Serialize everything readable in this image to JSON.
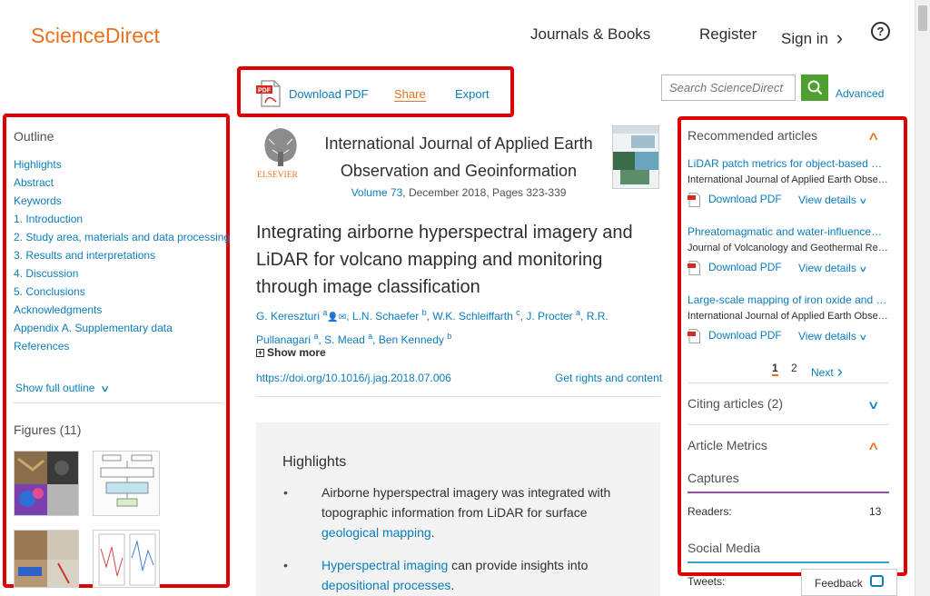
{
  "header": {
    "logo": "ScienceDirect",
    "nav_journals": "Journals & Books",
    "nav_register": "Register",
    "nav_signin": "Sign in",
    "signin_chevron": "›",
    "help": "?"
  },
  "toolbar": {
    "download_pdf": "Download PDF",
    "share": "Share",
    "export": "Export",
    "search_placeholder": "Search ScienceDirect",
    "advanced": "Advanced"
  },
  "outline": {
    "title": "Outline",
    "items": [
      "Highlights",
      "Abstract",
      "Keywords",
      "1. Introduction",
      "2. Study area, materials and data processing",
      "3. Results and interpretations",
      "4. Discussion",
      "5. Conclusions",
      "Acknowledgments",
      "Appendix A. Supplementary data",
      "References"
    ],
    "show_full": "Show full outline"
  },
  "figures": {
    "title": "Figures (11)"
  },
  "journal": {
    "name_line1": "International Journal of Applied Earth",
    "name_line2": "Observation and Geoinformation",
    "volume": "Volume 73",
    "volume_rest": ", December 2018, Pages 323-339",
    "publisher": "ELSEVIER"
  },
  "article": {
    "title": "Integrating airborne hyperspectral imagery and LiDAR for volcano mapping and monitoring through image classification",
    "authors": [
      {
        "name": "G. Kereszturi",
        "sup": "a"
      },
      {
        "name": "L.N. Schaefer",
        "sup": "b"
      },
      {
        "name": "W.K. Schleiffarth",
        "sup": "c"
      },
      {
        "name": "J. Procter",
        "sup": "a"
      },
      {
        "name": "R.R. Pullanagari",
        "sup": "a"
      },
      {
        "name": "S. Mead",
        "sup": "a"
      },
      {
        "name": "Ben Kennedy",
        "sup": "b"
      }
    ],
    "show_more": "Show more",
    "doi": "https://doi.org/10.1016/j.jag.2018.07.006",
    "rights": "Get rights and content"
  },
  "highlights": {
    "title": "Highlights",
    "bullet": "•",
    "item1_text": "Airborne hyperspectral imagery was integrated with topographic information from LiDAR for surface ",
    "item1_link": "geological mapping",
    "item1_end": ".",
    "item2_link1": "Hyperspectral imaging",
    "item2_text": " can provide insights into ",
    "item2_link2": "depositional processes",
    "item2_end": "."
  },
  "recommended": {
    "title": "Recommended articles",
    "download_pdf": "Download PDF",
    "view_details": "View details",
    "articles": [
      {
        "title": "LiDAR patch metrics for object-based clustering of forest types",
        "journal": "International Journal of Applied Earth Observation and Geoinformation"
      },
      {
        "title": "Phreatomagmatic and water-influenced eruptions",
        "journal": "Journal of Volcanology and Geothermal Research"
      },
      {
        "title": "Large-scale mapping of iron oxide and hydroxide minerals",
        "journal": "International Journal of Applied Earth Observation and Geoinformation"
      }
    ],
    "page_current": "1",
    "page_2": "2",
    "next": "Next"
  },
  "citing": {
    "title": "Citing articles (2)"
  },
  "metrics": {
    "title": "Article Metrics",
    "captures": "Captures",
    "readers_label": "Readers:",
    "readers_value": "13",
    "social": "Social Media",
    "tweets_label": "Tweets:"
  },
  "feedback": {
    "label": "Feedback"
  },
  "colors": {
    "brand_orange": "#e9711c",
    "link_blue": "#0c7dbb",
    "search_green": "#4f9f2e",
    "annotation_red": "#e10000",
    "captures_purple": "#a24bb5",
    "social_blue": "#37a4cc"
  }
}
